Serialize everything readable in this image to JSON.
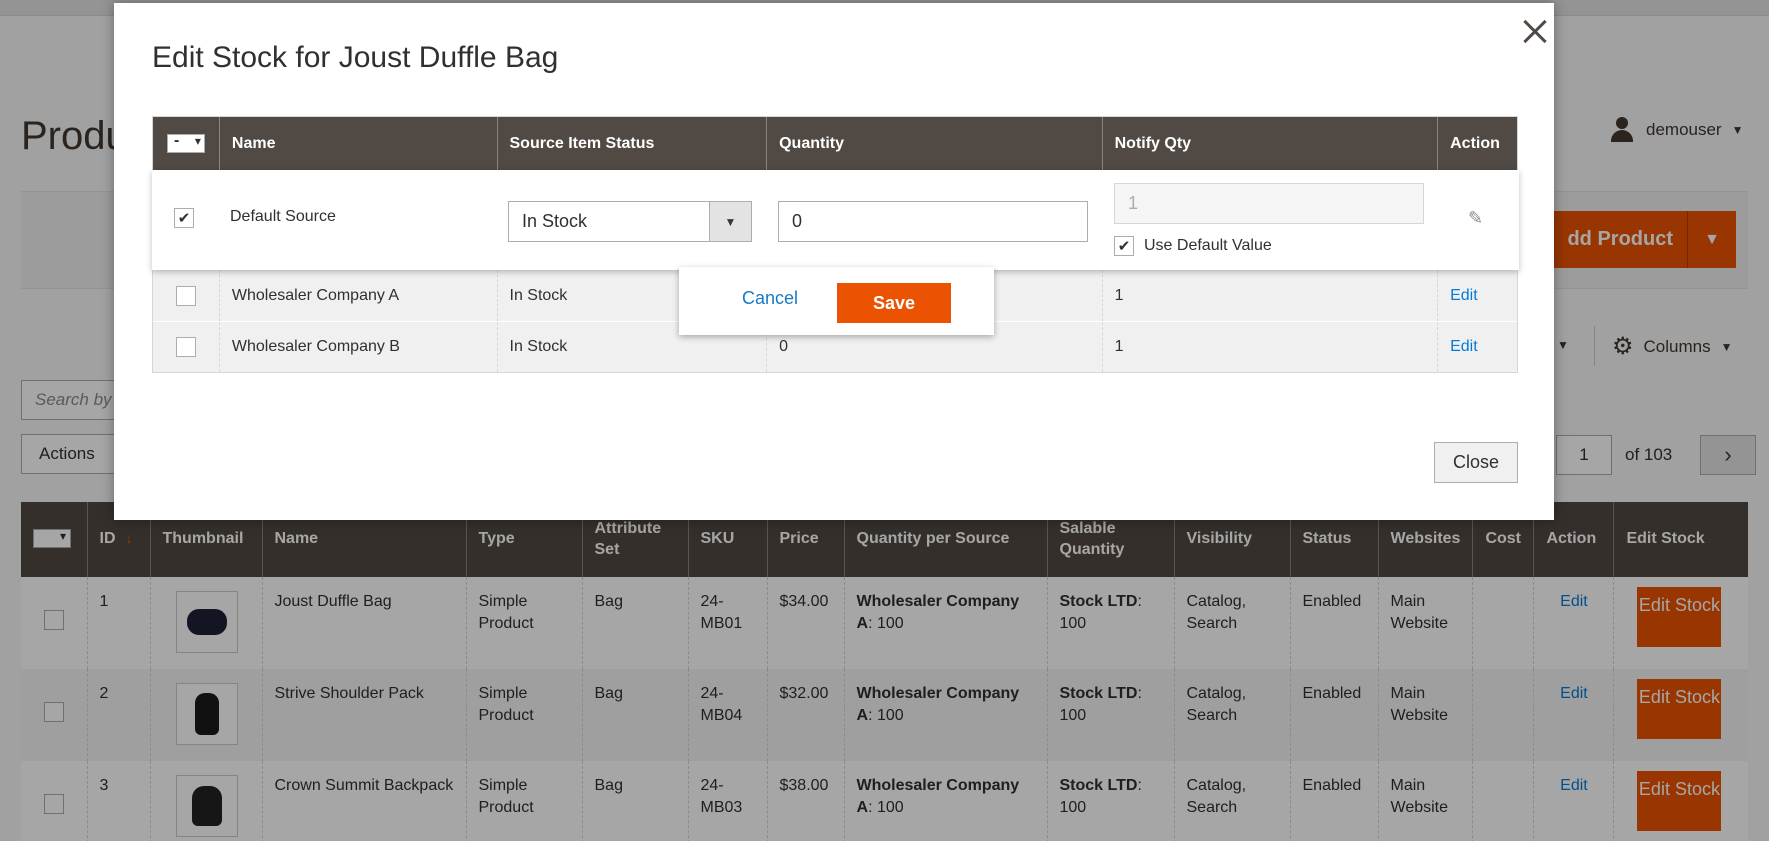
{
  "page": {
    "title": "Produ",
    "user": "demouser",
    "add_product": "dd Product",
    "columns": "Columns",
    "search_placeholder": "Search by",
    "actions": "Actions",
    "pager_current": "1",
    "pager_of": "of 103"
  },
  "grid": {
    "headers": [
      "ID",
      "Thumbnail",
      "Name",
      "Type",
      "Attribute Set",
      "SKU",
      "Price",
      "Quantity per Source",
      "Salable Quantity",
      "Visibility",
      "Status",
      "Websites",
      "Cost",
      "Action",
      "Edit Stock"
    ],
    "sort_icon": "↓",
    "rows": [
      {
        "id": "1",
        "name": "Joust Duffle Bag",
        "type": "Simple Product",
        "attr_set": "Bag",
        "sku": "24-MB01",
        "price": "$34.00",
        "qty_source_label": "Wholesaler Company A",
        "qty_source_value": ": 100",
        "salable_label": "Stock LTD",
        "salable_value": ": 100",
        "visibility": "Catalog, Search",
        "status": "Enabled",
        "websites": "Main Website",
        "cost": "",
        "action": "Edit",
        "edit_stock": "Edit Stock"
      },
      {
        "id": "2",
        "name": "Strive Shoulder Pack",
        "type": "Simple Product",
        "attr_set": "Bag",
        "sku": "24-MB04",
        "price": "$32.00",
        "qty_source_label": "Wholesaler Company A",
        "qty_source_value": ": 100",
        "salable_label": "Stock LTD",
        "salable_value": ": 100",
        "visibility": "Catalog, Search",
        "status": "Enabled",
        "websites": "Main Website",
        "cost": "",
        "action": "Edit",
        "edit_stock": "Edit Stock"
      },
      {
        "id": "3",
        "name": "Crown Summit Backpack",
        "type": "Simple Product",
        "attr_set": "Bag",
        "sku": "24-MB03",
        "price": "$38.00",
        "qty_source_label": "Wholesaler Company A",
        "qty_source_value": ": 100",
        "salable_label": "Stock LTD",
        "salable_value": ": 100",
        "visibility": "Catalog, Search",
        "status": "Enabled",
        "websites": "Main Website",
        "cost": "",
        "action": "Edit",
        "edit_stock": "Edit Stock"
      }
    ]
  },
  "modal": {
    "title": "Edit Stock for Joust Duffle Bag",
    "headers": {
      "name": "Name",
      "status": "Source Item Status",
      "quantity": "Quantity",
      "notify": "Notify Qty",
      "action": "Action"
    },
    "edit_row": {
      "name": "Default Source",
      "status": "In Stock",
      "quantity": "0",
      "notify": "1",
      "use_default": "Use Default Value",
      "checked_mark": "✔"
    },
    "rows": [
      {
        "name": "Wholesaler Company A",
        "status": "In Stock",
        "quantity": "",
        "notify": "1",
        "action": "Edit"
      },
      {
        "name": "Wholesaler Company B",
        "status": "In Stock",
        "quantity": "0",
        "notify": "1",
        "action": "Edit"
      }
    ],
    "cancel": "Cancel",
    "save": "Save",
    "close": "Close"
  },
  "icons": {
    "user": "user-icon",
    "gear": "gear-icon",
    "close": "close-icon",
    "pencil": "pencil-icon",
    "caret": "chevron-down-icon",
    "next": "chevron-right-icon"
  },
  "colors": {
    "accent": "#eb5202",
    "header": "#514943",
    "link": "#007bdb"
  }
}
